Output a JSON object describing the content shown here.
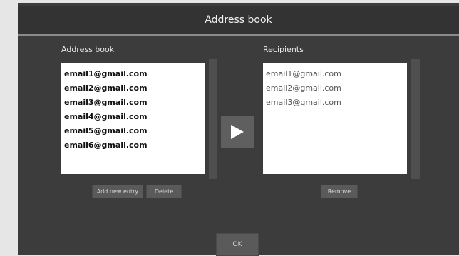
{
  "dialog": {
    "title": "Address book"
  },
  "address_book": {
    "label": "Address book",
    "items": [
      "email1@gmail.com",
      "email2@gmail.com",
      "email3@gmail.com",
      "email4@gmail.com",
      "email5@gmail.com",
      "email6@gmail.com"
    ],
    "add_button": "Add new entry",
    "delete_button": "Delete"
  },
  "recipients": {
    "label": "Recipients",
    "items": [
      "email1@gmail.com",
      "email2@gmail.com",
      "email3@gmail.com"
    ],
    "remove_button": "Remove"
  },
  "move_button": {
    "icon": "play-arrow-icon"
  },
  "footer": {
    "ok_button": "OK"
  }
}
